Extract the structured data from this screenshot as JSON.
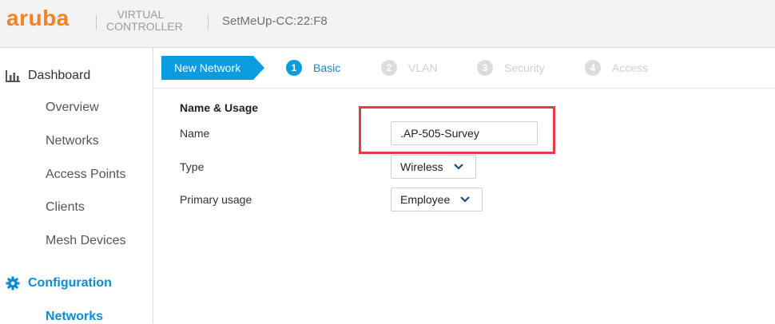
{
  "header": {
    "logo_text": "aruba",
    "product_line1": "VIRTUAL",
    "product_line2": "CONTROLLER",
    "controller_name": "SetMeUp-CC:22:F8"
  },
  "sidebar": {
    "dashboard_label": "Dashboard",
    "dashboard_items": [
      {
        "label": "Overview"
      },
      {
        "label": "Networks"
      },
      {
        "label": "Access Points"
      },
      {
        "label": "Clients"
      },
      {
        "label": "Mesh Devices"
      }
    ],
    "configuration_label": "Configuration",
    "configuration_items": [
      {
        "label": "Networks",
        "active": true
      }
    ]
  },
  "wizard": {
    "new_network_label": "New Network",
    "steps": [
      {
        "num": "1",
        "label": "Basic",
        "active": true
      },
      {
        "num": "2",
        "label": "VLAN",
        "active": false
      },
      {
        "num": "3",
        "label": "Security",
        "active": false
      },
      {
        "num": "4",
        "label": "Access",
        "active": false
      }
    ]
  },
  "form": {
    "section_title": "Name & Usage",
    "name_label": "Name",
    "name_value": ".AP-505-Survey",
    "type_label": "Type",
    "type_value": "Wireless",
    "usage_label": "Primary usage",
    "usage_value": "Employee"
  },
  "colors": {
    "brand": "#f58220",
    "accent": "#0a9be0",
    "highlight": "#e23d45"
  }
}
